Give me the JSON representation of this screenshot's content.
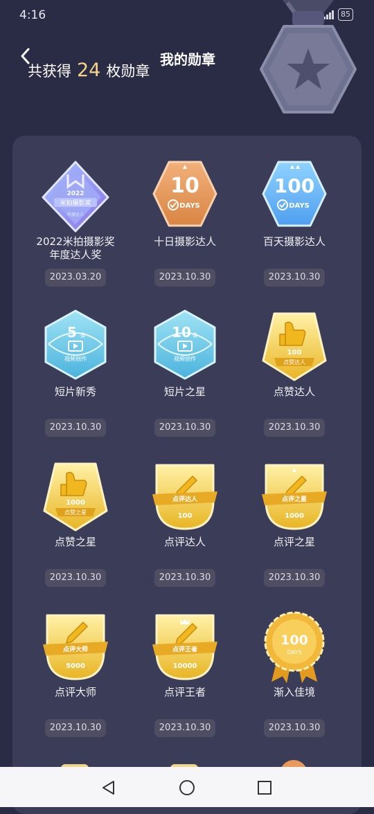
{
  "status": {
    "time": "4:16",
    "network": "4G",
    "battery": "85"
  },
  "header": {
    "title": "我的勋章",
    "summary_prefix": "共获得",
    "summary_count": "24",
    "summary_suffix": "枚勋章"
  },
  "medals": [
    {
      "name": "2022米拍摄影奖年度达人奖",
      "date": "2023.03.20",
      "icon_text": "2022",
      "icon_sub": "米拍摄影奖",
      "icon_sub2": "年度达人"
    },
    {
      "name": "十日摄影达人",
      "date": "2023.10.30",
      "icon_text": "10",
      "icon_sub": "DAYS"
    },
    {
      "name": "百天摄影达人",
      "date": "2023.10.30",
      "icon_text": "100",
      "icon_sub": "DAYS"
    },
    {
      "name": "短片新秀",
      "date": "2023.10.30",
      "icon_text": "5",
      "icon_unit": "条",
      "icon_sub": "视频创作"
    },
    {
      "name": "短片之星",
      "date": "2023.10.30",
      "icon_text": "10",
      "icon_unit": "条",
      "icon_sub": "视频创作"
    },
    {
      "name": "点赞达人",
      "date": "2023.10.30",
      "icon_text": "100",
      "icon_sub": "点赞达人"
    },
    {
      "name": "点赞之星",
      "date": "2023.10.30",
      "icon_text": "1000",
      "icon_sub": "点赞之星"
    },
    {
      "name": "点评达人",
      "date": "2023.10.30",
      "icon_text": "100",
      "icon_sub": "点评达人"
    },
    {
      "name": "点评之星",
      "date": "2023.10.30",
      "icon_text": "1000",
      "icon_sub": "点评之星"
    },
    {
      "name": "点评大师",
      "date": "2023.10.30",
      "icon_text": "5000",
      "icon_sub": "点评大师"
    },
    {
      "name": "点评王者",
      "date": "2023.10.30",
      "icon_text": "10000",
      "icon_sub": "点评王者"
    },
    {
      "name": "渐入佳境",
      "date": "2023.10.30",
      "icon_text": "100",
      "icon_sub": "DAYS"
    }
  ],
  "colors": {
    "background": "#2a2b45",
    "panel": "#3b3c58",
    "accent_count": "#f5d38a",
    "date_pill": "#4e4d62"
  },
  "nav": {
    "back": "back-triangle-icon",
    "home": "home-circle-icon",
    "recent": "recent-square-icon"
  }
}
